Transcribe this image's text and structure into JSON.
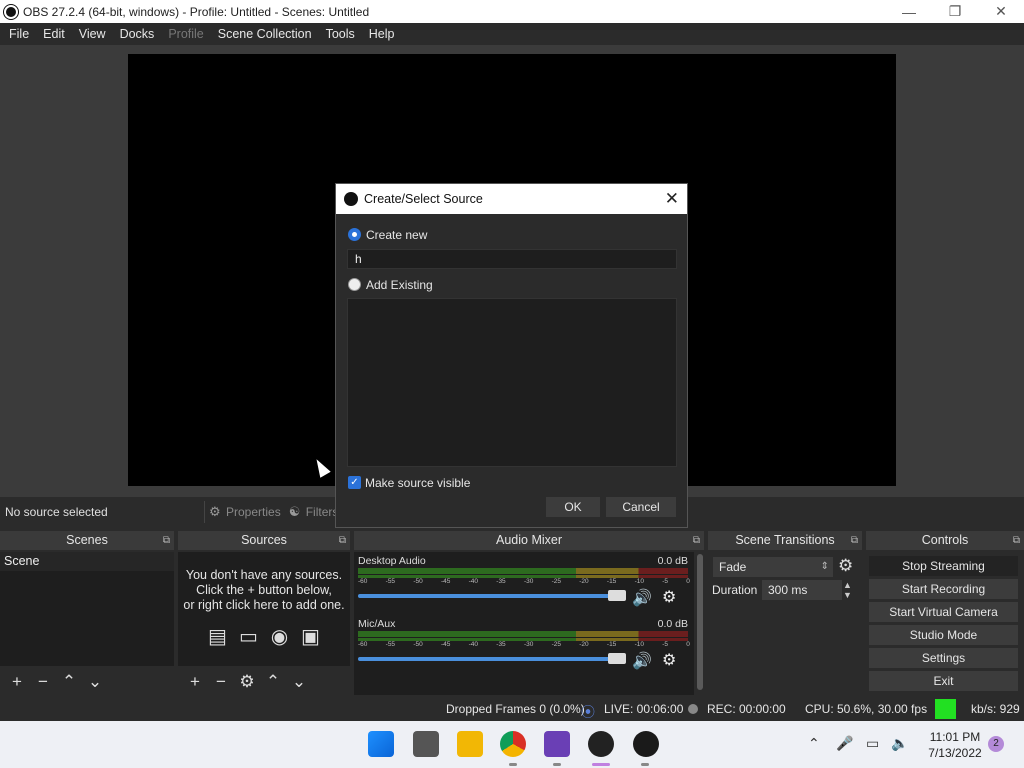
{
  "window": {
    "title": "OBS 27.2.4 (64-bit, windows) - Profile: Untitled - Scenes: Untitled"
  },
  "menu": [
    "File",
    "Edit",
    "View",
    "Docks",
    "Profile",
    "Scene Collection",
    "Tools",
    "Help"
  ],
  "source_toolbar": {
    "status": "No source selected",
    "properties": "Properties",
    "filters": "Filters"
  },
  "scenes": {
    "title": "Scenes",
    "items": [
      "Scene"
    ]
  },
  "sources": {
    "title": "Sources",
    "empty_line1": "You don't have any sources.",
    "empty_line2": "Click the + button below,",
    "empty_line3": "or right click here to add one."
  },
  "mixer": {
    "title": "Audio Mixer",
    "tracks": [
      {
        "name": "Desktop Audio",
        "db": "0.0 dB"
      },
      {
        "name": "Mic/Aux",
        "db": "0.0 dB"
      }
    ],
    "ticks": [
      "-60",
      "-55",
      "-50",
      "-45",
      "-40",
      "-35",
      "-30",
      "-25",
      "-20",
      "-15",
      "-10",
      "-5",
      "0"
    ]
  },
  "transitions": {
    "title": "Scene Transitions",
    "selected": "Fade",
    "duration_label": "Duration",
    "duration_value": "300 ms"
  },
  "controls": {
    "title": "Controls",
    "buttons": [
      "Stop Streaming",
      "Start Recording",
      "Start Virtual Camera",
      "Studio Mode",
      "Settings",
      "Exit"
    ]
  },
  "status": {
    "dropped": "Dropped Frames 0 (0.0%)",
    "live": "LIVE: 00:06:00",
    "rec": "REC: 00:00:00",
    "cpu": "CPU: 50.6%, 30.00 fps",
    "kbs": "kb/s: 929"
  },
  "dialog": {
    "title": "Create/Select Source",
    "create_new": "Create new",
    "name_value": "h",
    "add_existing": "Add Existing",
    "make_visible": "Make source visible",
    "ok": "OK",
    "cancel": "Cancel"
  },
  "taskbar": {
    "time": "11:01 PM",
    "date": "7/13/2022",
    "notifications": "2"
  },
  "colors": {
    "accent": "#2b72d9",
    "live_indicator": "#22e022",
    "preview": "#000000"
  }
}
